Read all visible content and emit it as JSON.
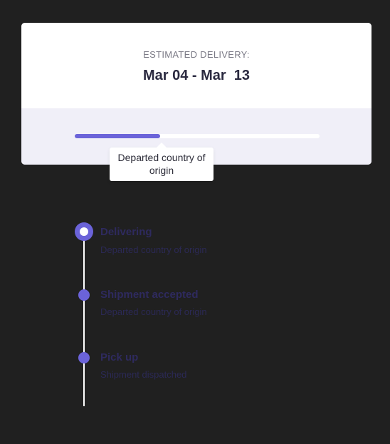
{
  "delivery": {
    "label": "ESTIMATED DELIVERY:",
    "date_range": "Mar 04 - Mar  13",
    "progress": 0.35,
    "tooltip": "Departed country of origin"
  },
  "timeline": [
    {
      "title": "Delivering",
      "subtitle": "Departed country of origin",
      "current": true
    },
    {
      "title": "Shipment accepted",
      "subtitle": "Departed country of origin",
      "current": false
    },
    {
      "title": "Pick up",
      "subtitle": "Shipment dispatched",
      "current": false
    }
  ],
  "colors": {
    "background": "#202020",
    "accent": "#6b63d9",
    "card": "#ffffff",
    "card_footer": "#f0eff8"
  }
}
